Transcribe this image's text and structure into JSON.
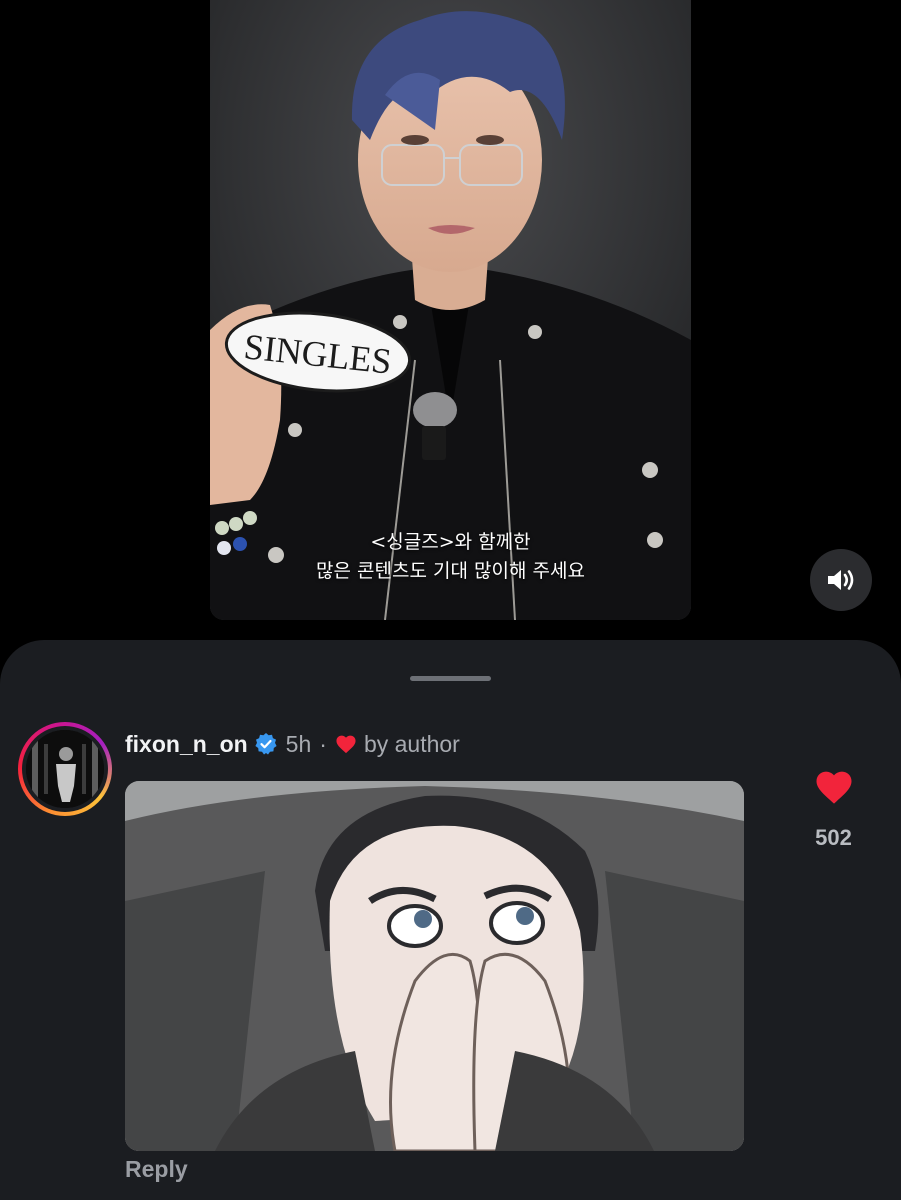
{
  "video": {
    "caption_line1": "<싱글즈>와 함께한",
    "caption_line2": "많은 콘텐츠도 기대 많이해 주세요",
    "sign_text": "SINGLES"
  },
  "controls": {
    "mute_icon": "speaker-icon"
  },
  "comment": {
    "username": "fixon_n_on",
    "time": "5h",
    "separator": "·",
    "liked_by_author": "by author",
    "like_count": "502",
    "reply_label": "Reply",
    "verified_icon": "verified-badge-icon"
  },
  "colors": {
    "heart": "#f2243b",
    "verified": "#3897f0",
    "sheet_bg": "#1b1d21"
  }
}
